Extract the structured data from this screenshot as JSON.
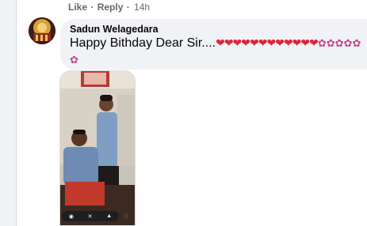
{
  "comment_actions": {
    "like_label": "Like",
    "separator": "·",
    "reply_label": "Reply",
    "timestamp": "14h"
  },
  "comment": {
    "author": "Sadun Welagedara",
    "text": "Happy Bithday Dear Sir....",
    "hearts_line1": "❤❤❤❤❤❤❤❤❤❤❤",
    "hearts_line2": "❤",
    "flowers": "✿✿✿✿✿✿"
  },
  "colors": {
    "bubble": "#f0f2f5",
    "text": "#050505",
    "meta": "#65676b",
    "heart": "#e3223a"
  }
}
